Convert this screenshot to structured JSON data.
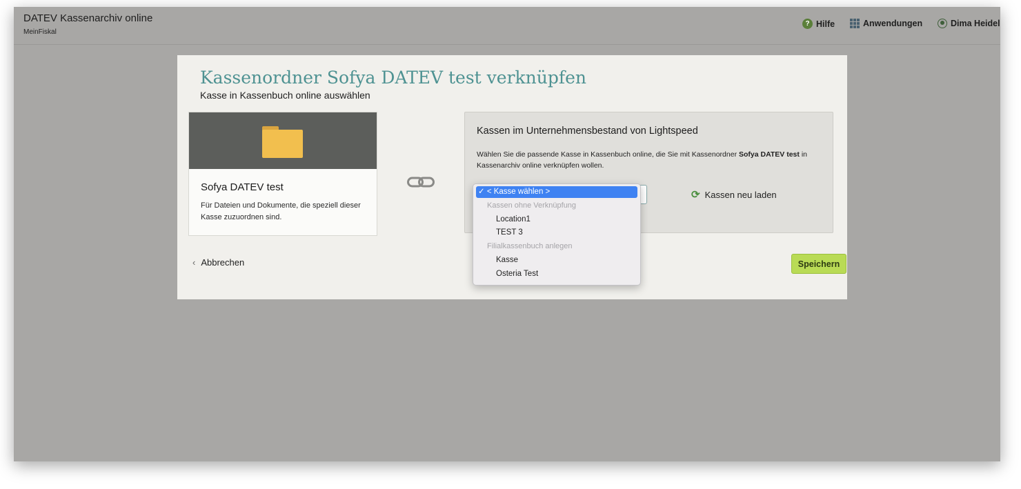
{
  "header": {
    "app_title": "DATEV Kassenarchiv online",
    "app_subtitle": "MeinFiskal",
    "help_label": "Hilfe",
    "apps_label": "Anwendungen",
    "user_label": "Dima Heidel"
  },
  "page": {
    "title": "Kassenordner Sofya DATEV test verknüpfen",
    "subtitle": "Kasse in Kassenbuch online auswählen"
  },
  "folder_card": {
    "name": "Sofya DATEV test",
    "description": "Für Dateien und Dokumente, die speziell dieser Kasse zuzuordnen sind."
  },
  "register_card": {
    "title": "Kassen im Unternehmensbestand von Lightspeed",
    "description_prefix": "Wählen Sie die passende Kasse in Kassenbuch online, die Sie mit Kassenordner ",
    "description_bold": "Sofya DATEV test",
    "description_suffix": " in Kassenarchiv online verknüpfen wollen.",
    "reload_label": "Kassen neu laden"
  },
  "dropdown": {
    "selected": "✓ < Kasse wählen >",
    "group1_label": "Kassen ohne Verknüpfung",
    "group1_options": [
      "Location1",
      "TEST 3"
    ],
    "group2_label": "Filialkassenbuch anlegen",
    "group2_options": [
      "Kasse",
      "Osteria Test"
    ]
  },
  "actions": {
    "cancel_label": "Abbrechen",
    "save_label": "Speichern"
  },
  "colors": {
    "accent_heading": "#4e9292",
    "save_button": "#b9db55",
    "select_highlight": "#3f82f2",
    "folder": "#f2bf4e"
  }
}
